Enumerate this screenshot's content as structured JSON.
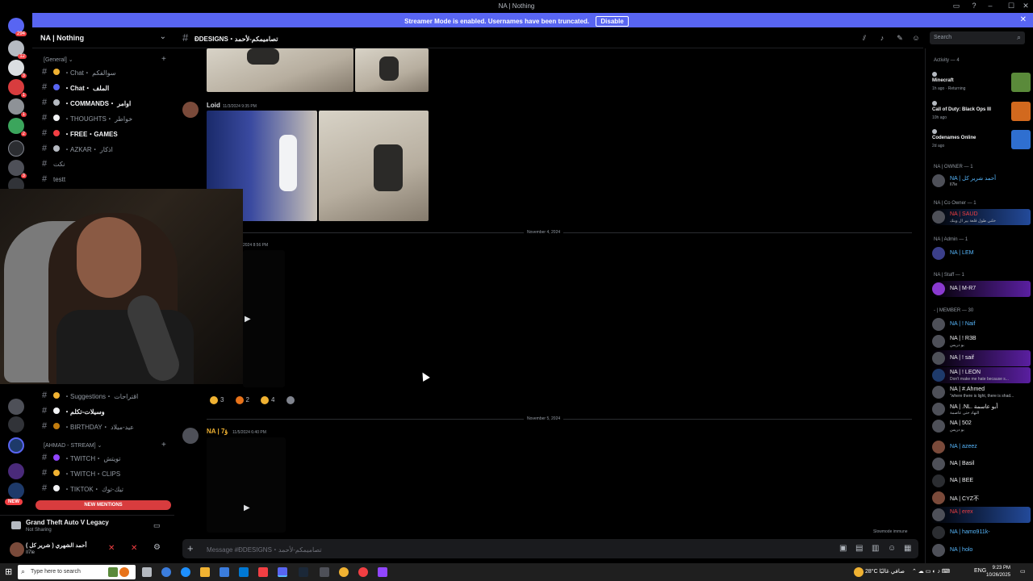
{
  "window": {
    "title": "NA | Nothing",
    "minimize": "–",
    "maximize": "☐",
    "close": "✕"
  },
  "streamer_banner": {
    "message": "Streamer Mode is enabled. Usernames have been truncated.",
    "disable_label": "Disable",
    "close_icon": "✕"
  },
  "servers": {
    "home_badge": "294",
    "items": [
      {
        "badge": "12"
      },
      {
        "badge": "3"
      },
      {
        "badge": "1"
      },
      {
        "badge": "1"
      },
      {
        "badge": "2"
      },
      {
        "badge": ""
      },
      {
        "badge": "3"
      },
      {
        "badge": ""
      }
    ],
    "new_label": "NEW"
  },
  "guild": {
    "name": "NA | Nothing",
    "categories": {
      "general": "[General]",
      "ahmad_stream": "[AHMAD - STREAM]"
    },
    "channels": [
      {
        "label": "・Chat・ سوالفكم",
        "bold": false,
        "color": "#f0b232"
      },
      {
        "label": "・Chat・ الملف",
        "bold": true,
        "color": "#5865f2"
      },
      {
        "label": "・COMMANDS・ اوامر",
        "bold": true,
        "color": "#b5bac1"
      },
      {
        "label": "・THOUGHTS・ خواطر",
        "bold": false,
        "color": "#f2f3f5"
      },
      {
        "label": "・FREE・GAMES",
        "bold": true,
        "color": "#f23f43"
      },
      {
        "label": "・AZKAR・ اذكار",
        "bold": false,
        "color": "#b5bac1"
      },
      {
        "label": "نكت",
        "bold": false,
        "color": ""
      },
      {
        "label": "testt",
        "bold": false,
        "color": ""
      },
      {
        "label": "・Suggestions・ اقتراحات",
        "bold": false,
        "color": "#f0b232"
      },
      {
        "label": "・وسيلات-تكلم",
        "bold": true,
        "color": "#f2f3f5"
      },
      {
        "label": "・BIRTHDAY・ عيد-ميلاد",
        "bold": false,
        "color": "#c27c0e"
      },
      {
        "label": "・TWITCH・ تويتش",
        "bold": false,
        "color": "#9146ff"
      },
      {
        "label": "・TWITCH・CLIPS",
        "bold": false,
        "color": "#f0b232"
      },
      {
        "label": "・TIKTOK・ تيك-توك",
        "bold": false,
        "color": "#f2f3f5"
      }
    ],
    "new_mentions": "NEW MENTIONS"
  },
  "activity_bar": {
    "game": "Grand Theft Auto V Legacy",
    "status": "Not Sharing"
  },
  "user_panel": {
    "name": "أحمد الشهري ( شرير كل )",
    "status": "Il7le"
  },
  "channel_header": {
    "name": "ĐDESIGNS・تصاميمكم-لأحمد",
    "search_placeholder": "Search"
  },
  "messages": [
    {
      "author": "Loid",
      "timestamp": "11/3/2024 9:35 PM",
      "author_color": "#f2f3f5"
    },
    {
      "author": "",
      "timestamp": "2024 8:56 PM",
      "author_color": "#f2f3f5"
    },
    {
      "author": "NA | 7ؤ",
      "timestamp": "11/5/2024 6:40 PM",
      "author_color": "#f0b232"
    }
  ],
  "dividers": [
    "November 4, 2024",
    "November 5, 2024"
  ],
  "reactions": [
    {
      "count": "3",
      "color": "#f0b232"
    },
    {
      "count": "2",
      "color": "#e8731a"
    },
    {
      "count": "4",
      "color": "#f0b232"
    },
    {
      "count": "",
      "color": "#80848e"
    }
  ],
  "composer": {
    "placeholder": "Message #ĐDESIGNS・تصاميمكم-لأحمد",
    "slowmode": "Slowmode immune"
  },
  "members_panel": {
    "activity_title": "Activity — 4",
    "games": [
      {
        "name": "Minecraft",
        "sub": "1h ago · Returning",
        "art": "#5a8a3a"
      },
      {
        "name": "Call of Duty: Black Ops III",
        "sub": "10h ago",
        "art": "#d2691e"
      },
      {
        "name": "Codenames Online",
        "sub": "2d ago",
        "art": "#2f6fd0"
      }
    ],
    "roles": {
      "owner": "NA | OWNER — 1",
      "coowner": "NA | Co Owner — 1",
      "admin": "NA | Admin — 1",
      "staff": "NA | Staff — 1",
      "member": "- | MEMBER — 30"
    },
    "members": [
      {
        "name": "NA | أحمد شرير كل",
        "status": "Il7le",
        "color": "#58b9ff",
        "tag": ""
      },
      {
        "name": "NA | SAUD",
        "status": "خلني طول قلعة بير ال وينك",
        "color": "#f23f43",
        "tag": ""
      },
      {
        "name": "NA | LEM",
        "status": "",
        "color": "#58b9ff",
        "tag": ""
      },
      {
        "name": "NA | M-R7",
        "status": "",
        "color": "#f2f3f5",
        "tag": ""
      },
      {
        "name": "NA | ! Naif",
        "status": "",
        "color": "#58b9ff",
        "tag": ""
      },
      {
        "name": "NA | ! R3B",
        "status": "بو دريس",
        "color": "#f2f3f5",
        "tag": "DRV"
      },
      {
        "name": "NA | ! saif",
        "status": "",
        "color": "#f2f3f5",
        "tag": "DVR"
      },
      {
        "name": "NA | ! LEON",
        "status": "Don't make me hate because s...",
        "color": "#f2f3f5",
        "tag": ""
      },
      {
        "name": "NA | #.Ahmed",
        "status": "\"where there is light, there is shad...",
        "color": "#f2f3f5",
        "tag": ""
      },
      {
        "name": "NA | .NL. أبو عاسمة",
        "status": "التهاد حتى عاصمة",
        "color": "#f2f3f5",
        "tag": "AWT"
      },
      {
        "name": "NA | 502",
        "status": "بو دريس",
        "color": "#f2f3f5",
        "tag": "11tv"
      },
      {
        "name": "NA | azeez",
        "status": "",
        "color": "#58b9ff",
        "tag": ""
      },
      {
        "name": "NA | Basil",
        "status": "",
        "color": "#f2f3f5",
        "tag": ""
      },
      {
        "name": "NA | BEE",
        "status": "",
        "color": "#f2f3f5",
        "tag": ""
      },
      {
        "name": "NA | CYZ不",
        "status": "",
        "color": "#f2f3f5",
        "tag": ""
      },
      {
        "name": "NA | erex",
        "status": "",
        "color": "#f23f43",
        "tag": ""
      },
      {
        "name": "NA | hamo911k-",
        "status": "",
        "color": "#58b9ff",
        "tag": ""
      },
      {
        "name": "NA | holo",
        "status": "",
        "color": "#58b9ff",
        "tag": ""
      }
    ]
  },
  "taskbar": {
    "search_placeholder": "Type here to search",
    "weather": "28°C  صافي غالبًا",
    "lang": "ENG",
    "time": "9:23 PM",
    "date": "10/26/2025"
  }
}
